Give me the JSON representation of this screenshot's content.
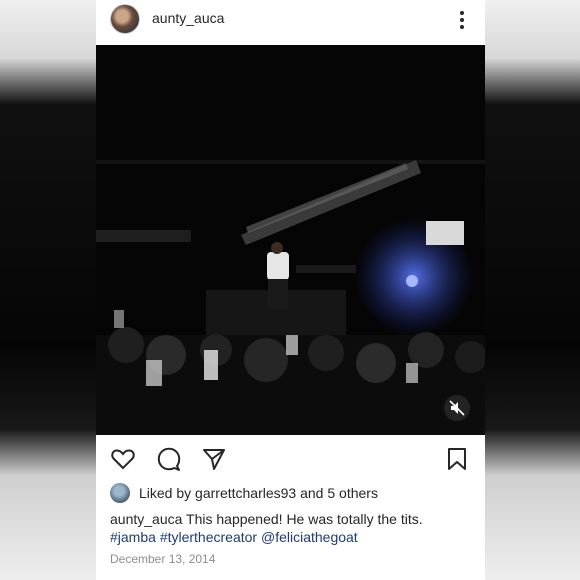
{
  "post": {
    "username": "aunty_auca",
    "caption_username": "aunty_auca",
    "caption_text": " This happened!  He was totally the tits.",
    "hashtags": [
      "#jamba",
      "#tylerthecreator",
      "@feliciathegoat"
    ],
    "date": "December 13, 2014"
  },
  "likes": {
    "prefix": "Liked by ",
    "liker": "garrettcharles93",
    "middle": " and ",
    "others": "5 others"
  },
  "icons": {
    "menu": "more-vertical-icon",
    "like": "heart-icon",
    "comment": "comment-icon",
    "share": "send-icon",
    "save": "bookmark-icon",
    "mute": "speaker-muted-icon"
  },
  "colors": {
    "text": "#262626",
    "link": "#1f3b74",
    "muted": "#8e8e8e"
  }
}
